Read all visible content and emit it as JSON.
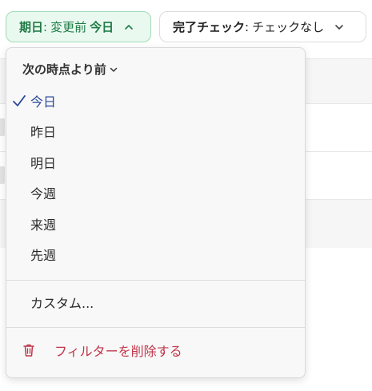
{
  "filters": {
    "due": {
      "field": "期日",
      "colon": ":",
      "operator": "変更前",
      "value": "今日"
    },
    "done": {
      "field": "完了チェック",
      "colon": ":",
      "value": "チェックなし"
    }
  },
  "menu": {
    "section_label": "次の時点より前",
    "options": [
      {
        "label": "今日",
        "selected": true
      },
      {
        "label": "昨日",
        "selected": false
      },
      {
        "label": "明日",
        "selected": false
      },
      {
        "label": "今週",
        "selected": false
      },
      {
        "label": "来週",
        "selected": false
      },
      {
        "label": "先週",
        "selected": false
      }
    ],
    "custom_label": "カスタム...",
    "delete_label": "フィルターを削除する"
  },
  "colors": {
    "chip_active_bg": "#e9f9ef",
    "chip_active_text": "#1f7a46",
    "selected_text": "#27479a",
    "danger": "#c0364a"
  },
  "icons": [
    "chevron-up-icon",
    "chevron-down-icon",
    "checkmark-icon",
    "trash-icon"
  ]
}
